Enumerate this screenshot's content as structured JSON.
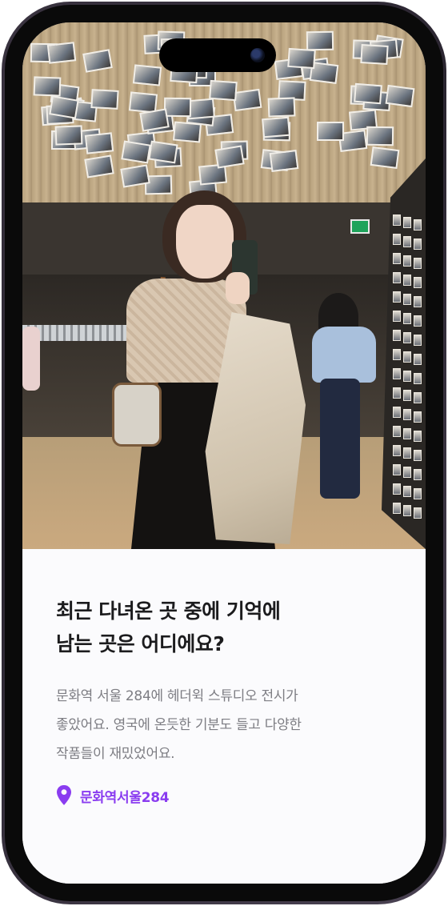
{
  "post": {
    "question_line1": "최근 다녀온 곳 중에 기억에",
    "question_line2": "남는 곳은 어디에요?",
    "answer_line1": "문화역 서울 284에 헤더윅 스튜디오 전시가",
    "answer_line2": "좋았어요. 영국에 온듯한 기분도 들고 다양한",
    "answer_line3": "작품들이 재밌었어요.",
    "location": "문화역서울284"
  },
  "icons": {
    "location": "location-pin-icon"
  },
  "colors": {
    "accent": "#8a3cf0",
    "title": "#1c1c1e",
    "body_text": "#7d7d83",
    "background": "#fbfbfd"
  }
}
